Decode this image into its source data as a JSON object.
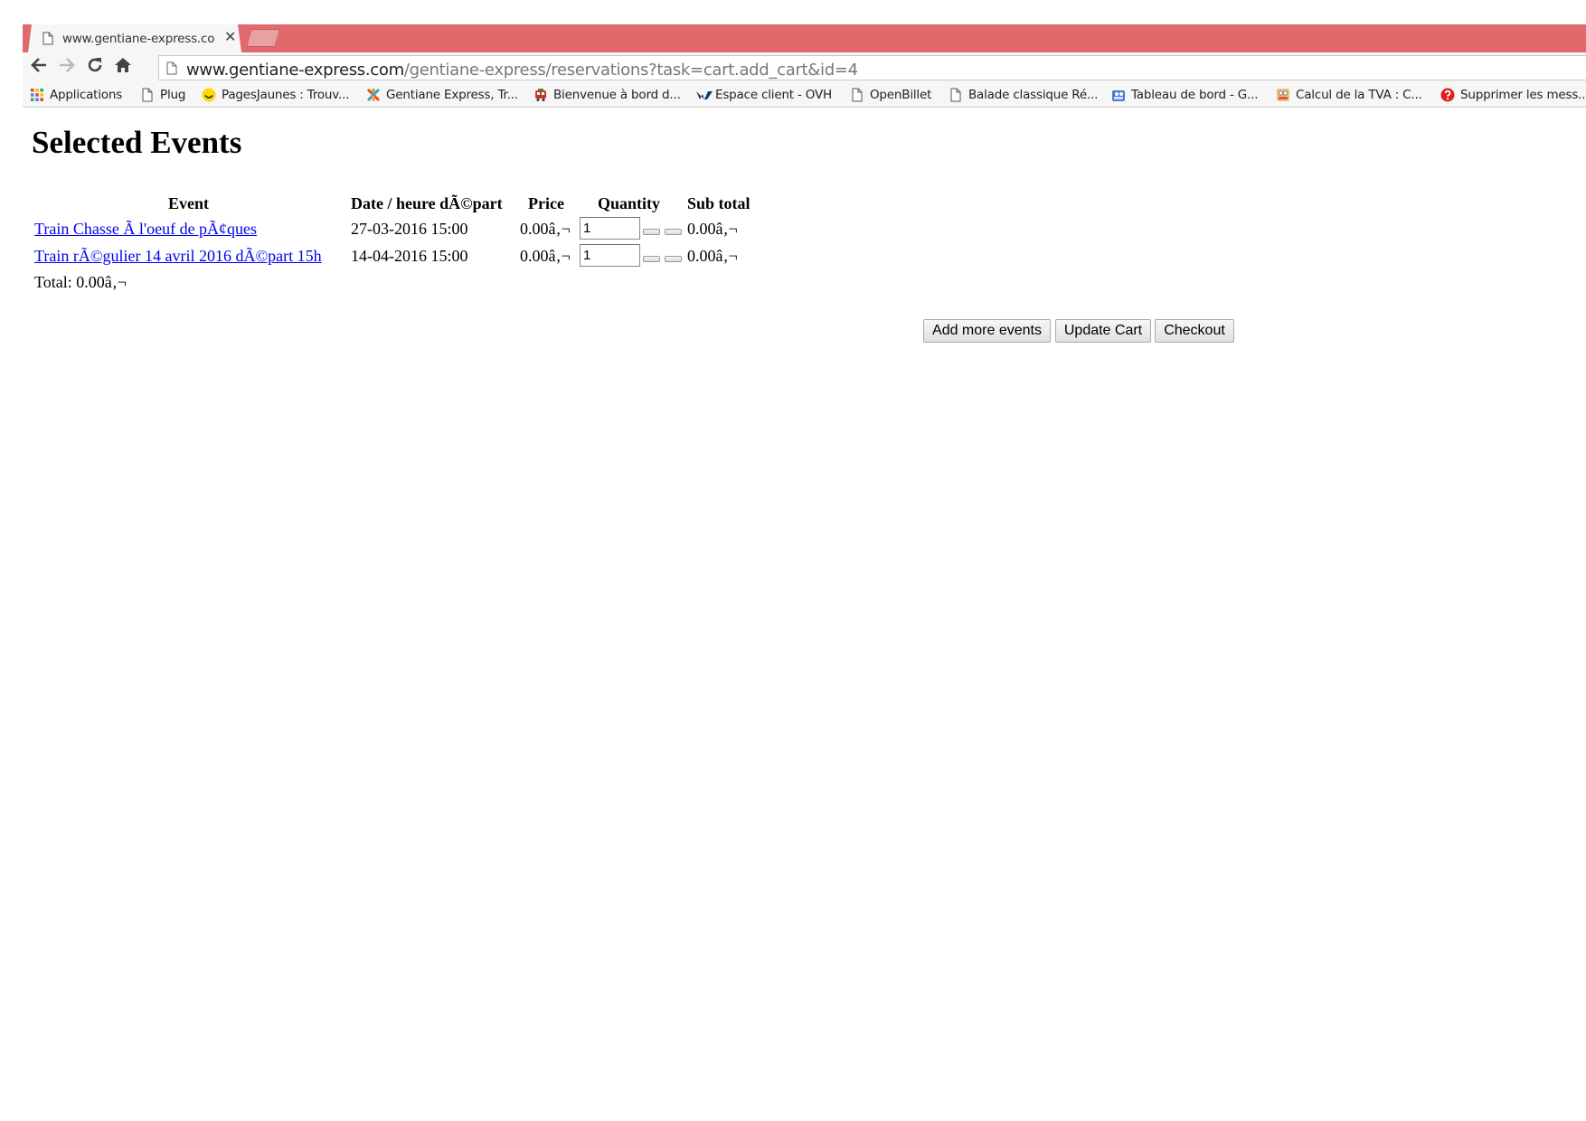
{
  "browser": {
    "tab_title": "www.gentiane-express.com",
    "url_host": "www.gentiane-express.com",
    "url_path": "/gentiane-express/reservations?task=cart.add_cart&id=4",
    "bookmarks": [
      {
        "label": "Applications",
        "icon": "apps-grid-icon"
      },
      {
        "label": "Plug",
        "icon": "page-icon"
      },
      {
        "label": "PagesJaunes : Trouv...",
        "icon": "smiley-icon"
      },
      {
        "label": "Gentiane Express, Tr...",
        "icon": "joomla-icon"
      },
      {
        "label": "Bienvenue à bord d...",
        "icon": "train-icon"
      },
      {
        "label": "Espace client - OVH",
        "icon": "ovh-icon"
      },
      {
        "label": "OpenBillet",
        "icon": "page-icon"
      },
      {
        "label": "Balade classique Ré...",
        "icon": "page-icon"
      },
      {
        "label": "Tableau de bord - G...",
        "icon": "dashboard-icon"
      },
      {
        "label": "Calcul de la TVA : C...",
        "icon": "calculator-icon"
      },
      {
        "label": "Supprimer les mess...",
        "icon": "help-icon"
      }
    ]
  },
  "page": {
    "title": "Selected Events",
    "columns": {
      "event": "Event",
      "date": "Date / heure dÃ©part",
      "price": "Price",
      "quantity": "Quantity",
      "subtotal": "Sub total"
    },
    "rows": [
      {
        "event": "Train Chasse Ã  l'oeuf de pÃ¢ques",
        "date": "27-03-2016 15:00",
        "price": "0.00â‚¬",
        "quantity": "1",
        "subtotal": "0.00â‚¬"
      },
      {
        "event": "Train rÃ©gulier 14 avril 2016 dÃ©part 15h",
        "date": "14-04-2016 15:00",
        "price": "0.00â‚¬",
        "quantity": "1",
        "subtotal": "0.00â‚¬"
      }
    ],
    "total": "Total: 0.00â‚¬",
    "buttons": {
      "add_more": "Add more events",
      "update": "Update Cart",
      "checkout": "Checkout"
    }
  },
  "colors": {
    "tabstrip": "#e0696b",
    "link": "#0000ee"
  }
}
